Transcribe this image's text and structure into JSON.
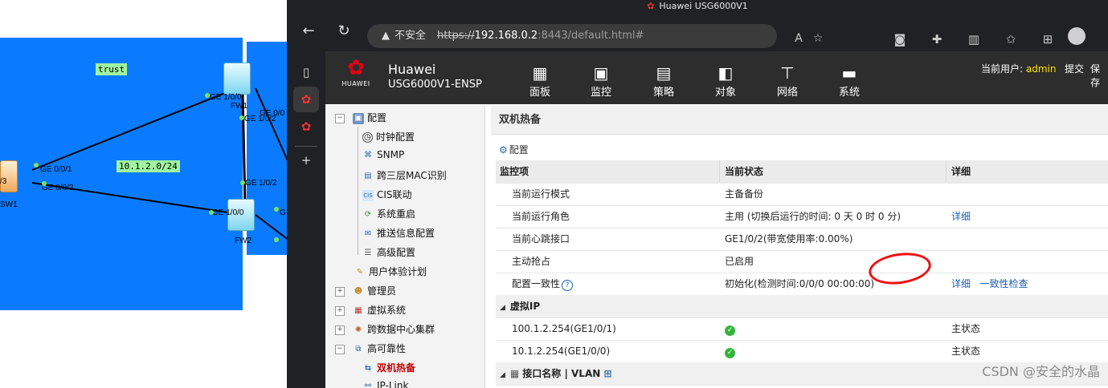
{
  "topology": {
    "zone_tag": "trust",
    "subnet_tag": "10.1.2.0/24",
    "devices": [
      "FW1",
      "FW2",
      "SW1"
    ],
    "port_labels": {
      "fw1_g100": "GE 1/0/0",
      "fw1_g002": "GE 0/0",
      "fw1_g102": "GE 1/0/2",
      "fw2_g102": "GE 1/0/2",
      "fw2_g100": "GE 1/0/0",
      "sw1_g001": "GE 0/0/1",
      "sw1_g002": "GE 0/0/2",
      "sw1_side": "/3",
      "fw2_right": "G"
    }
  },
  "browser": {
    "window_title": "Huawei USG6000V1",
    "security_label": "不安全",
    "url_scheme": "https://",
    "url_host": "192.168.0.2",
    "url_rest": ":8443/default.html#"
  },
  "app": {
    "brand": "HUAWEI",
    "product_name": "Huawei",
    "product_model": "USG6000V1-ENSP",
    "nav": [
      "面板",
      "监控",
      "策略",
      "对象",
      "网络",
      "系统"
    ],
    "current_user_label": "当前用户:",
    "current_user": "admin",
    "submit_label": "提交",
    "save_label": "保存"
  },
  "tree": {
    "root": "配置",
    "config_children": [
      "时钟配置",
      "SNMP",
      "跨三层MAC识别",
      "CIS联动",
      "系统重启",
      "推送信息配置",
      "高级配置"
    ],
    "other": [
      "用户体验计划",
      "管理员",
      "虚拟系统",
      "跨数据中心集群",
      "高可靠性"
    ],
    "ha_children": [
      "双机热备",
      "IP-Link"
    ]
  },
  "main": {
    "title": "双机热备",
    "config_link": "配置",
    "headers": [
      "监控项",
      "当前状态",
      "详细"
    ],
    "rows": [
      {
        "item": "当前运行模式",
        "status": "主备备份",
        "detail": ""
      },
      {
        "item": "当前运行角色",
        "status": "主用 (切换后运行的时间: 0 天 0 时 0 分)",
        "detail": "详细"
      },
      {
        "item": "当前心跳接口",
        "status": "GE1/0/2(带宽使用率:0.00%)",
        "detail": ""
      },
      {
        "item": "主动抢占",
        "status": "已启用",
        "detail": ""
      },
      {
        "item": "配置一致性",
        "status": "初始化(检测时间:0/0/0 00:00:00)",
        "detail": "详细",
        "detail2": "一致性检查"
      }
    ],
    "vip_group": "虚拟IP",
    "vip_rows": [
      {
        "ip": "100.1.2.254(GE1/0/1)",
        "detail": "主状态"
      },
      {
        "ip": "10.1.2.254(GE1/0/0)",
        "detail": "主状态"
      }
    ],
    "iface_group": "接口名称 | VLAN"
  },
  "watermark": "CSDN @安全的水晶"
}
